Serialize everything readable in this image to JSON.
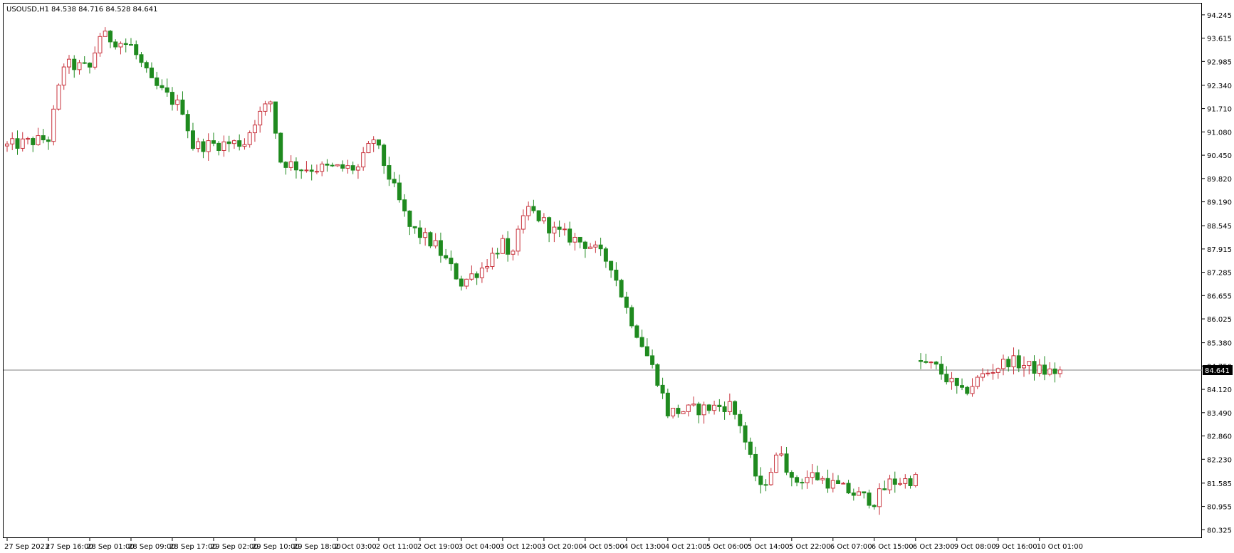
{
  "chart_header": {
    "symbol": "USOUSD,H1",
    "ohlc": "84.538 84.716 84.528 84.641"
  },
  "colors": {
    "bull": "#c8323c",
    "bear": "#1f8a1f",
    "grid_frame": "#000000",
    "bid_line": "#7f7f7f",
    "price_tag_bg": "#000000",
    "price_tag_text": "#ffffff"
  },
  "chart_data": {
    "type": "candlestick",
    "title": "USOUSD,H1",
    "current_price_label": "84.641",
    "current_price": 84.641,
    "ylim": [
      80.1,
      94.55
    ],
    "y_ticks": [
      "94.245",
      "93.615",
      "92.985",
      "92.340",
      "91.710",
      "91.080",
      "90.450",
      "89.820",
      "89.190",
      "88.545",
      "87.915",
      "87.285",
      "86.655",
      "86.025",
      "85.380",
      "84.750",
      "84.120",
      "83.490",
      "82.860",
      "82.230",
      "81.585",
      "80.955",
      "80.325"
    ],
    "x_labels": [
      "27 Sep 2023",
      "27 Sep 16:00",
      "28 Sep 01:00",
      "28 Sep 09:00",
      "28 Sep 17:00",
      "29 Sep 02:00",
      "29 Sep 10:00",
      "29 Sep 18:00",
      "2 Oct 03:00",
      "2 Oct 11:00",
      "2 Oct 19:00",
      "3 Oct 04:00",
      "3 Oct 12:00",
      "3 Oct 20:00",
      "4 Oct 05:00",
      "4 Oct 13:00",
      "4 Oct 21:00",
      "5 Oct 06:00",
      "5 Oct 14:00",
      "5 Oct 22:00",
      "6 Oct 07:00",
      "6 Oct 15:00",
      "6 Oct 23:00",
      "9 Oct 08:00",
      "9 Oct 16:00",
      "10 Oct 01:00"
    ],
    "x_label_bars": [
      0,
      8,
      16,
      24,
      32,
      40,
      48,
      56,
      64,
      72,
      80,
      88,
      96,
      104,
      112,
      120,
      128,
      136,
      144,
      152,
      160,
      168,
      176,
      184,
      192,
      200
    ],
    "bars_total": 209,
    "path": [
      [
        0,
        90.7
      ],
      [
        8,
        90.9
      ],
      [
        11,
        92.9
      ],
      [
        16,
        92.8
      ],
      [
        18,
        93.7
      ],
      [
        24,
        93.4
      ],
      [
        28,
        92.4
      ],
      [
        34,
        91.7
      ],
      [
        36,
        90.7
      ],
      [
        46,
        90.8
      ],
      [
        48,
        91.4
      ],
      [
        51,
        91.9
      ],
      [
        53,
        90.3
      ],
      [
        57,
        90.1
      ],
      [
        68,
        90.1
      ],
      [
        71,
        90.9
      ],
      [
        78,
        88.5
      ],
      [
        83,
        88.0
      ],
      [
        88,
        87.0
      ],
      [
        92,
        87.4
      ],
      [
        96,
        88.1
      ],
      [
        97,
        87.6
      ],
      [
        101,
        89.0
      ],
      [
        106,
        88.4
      ],
      [
        113,
        88.0
      ],
      [
        117,
        87.5
      ],
      [
        120,
        86.3
      ],
      [
        126,
        84.4
      ],
      [
        128,
        83.5
      ],
      [
        135,
        83.6
      ],
      [
        140,
        83.7
      ],
      [
        142,
        83.2
      ],
      [
        144,
        82.2
      ],
      [
        146,
        81.4
      ],
      [
        150,
        82.5
      ],
      [
        152,
        81.6
      ],
      [
        156,
        81.8
      ],
      [
        164,
        81.3
      ],
      [
        168,
        81.1
      ],
      [
        171,
        81.6
      ],
      [
        176,
        81.7
      ]
    ],
    "gap_path": [
      [
        176,
        84.9
      ],
      [
        180,
        84.7
      ],
      [
        185,
        84.0
      ],
      [
        189,
        84.5
      ],
      [
        194,
        84.9
      ],
      [
        201,
        84.6
      ],
      [
        204,
        84.6
      ]
    ]
  }
}
